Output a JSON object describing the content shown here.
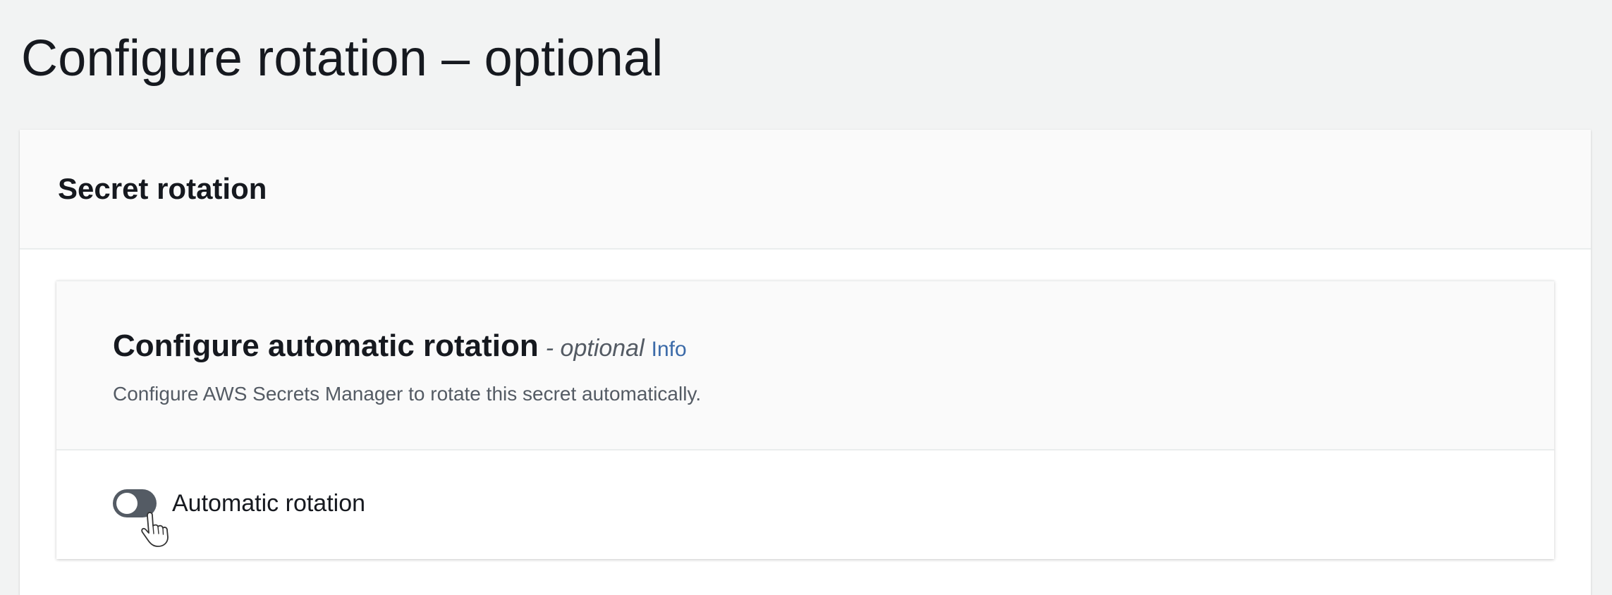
{
  "page": {
    "title": "Configure rotation – optional"
  },
  "secret_rotation_panel": {
    "title": "Secret rotation"
  },
  "automatic_rotation_section": {
    "title": "Configure automatic rotation",
    "optional_label": "- optional",
    "info_link": "Info",
    "description": "Configure AWS Secrets Manager to rotate this secret automatically.",
    "toggle": {
      "label": "Automatic rotation",
      "state": "off"
    }
  },
  "colors": {
    "page_background": "#f2f3f3",
    "info_link": "#3b6aa8",
    "toggle_off": "#545b64"
  },
  "icons": {
    "cursor": "hand-pointer-icon"
  }
}
